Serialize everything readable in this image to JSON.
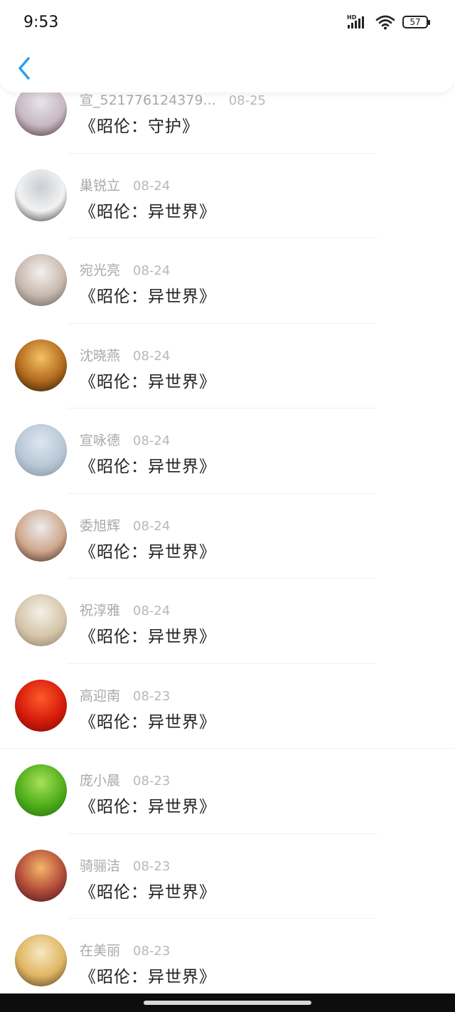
{
  "status_bar": {
    "time": "9:53",
    "hd_label": "HD",
    "battery": "57"
  },
  "nav": {
    "back_icon": "chevron-left-icon",
    "accent_color": "#2a9df4"
  },
  "entries": [
    {
      "name": "宣_521776124379...",
      "date": "08-25",
      "title": "《昭伦：守护》",
      "avatar_colors": [
        "#e8e4ea",
        "#c7b8c4",
        "#3b2a2b"
      ]
    },
    {
      "name": "巢锐立",
      "date": "08-24",
      "title": "《昭伦：异世界》",
      "avatar_colors": [
        "#c9cfd4",
        "#f2f2f2",
        "#2d2d2d"
      ]
    },
    {
      "name": "宛光亮",
      "date": "08-24",
      "title": "《昭伦：异世界》",
      "avatar_colors": [
        "#f4f1ef",
        "#c7b9ae",
        "#5d5a57"
      ]
    },
    {
      "name": "沈晓燕",
      "date": "08-24",
      "title": "《昭伦：异世界》",
      "avatar_colors": [
        "#f6c267",
        "#b26a1c",
        "#1e1206"
      ]
    },
    {
      "name": "宣咏德",
      "date": "08-24",
      "title": "《昭伦：异世界》",
      "avatar_colors": [
        "#dbe6f1",
        "#b9c8d6",
        "#7f8c97"
      ]
    },
    {
      "name": "委旭辉",
      "date": "08-24",
      "title": "《昭伦：异世界》",
      "avatar_colors": [
        "#ececec",
        "#cfa88d",
        "#3a1f1a"
      ]
    },
    {
      "name": "祝淳雅",
      "date": "08-24",
      "title": "《昭伦：异世界》",
      "avatar_colors": [
        "#f4f0e8",
        "#d6c6aa",
        "#8a7a66"
      ]
    },
    {
      "name": "高迎南",
      "date": "08-23",
      "title": "《昭伦：异世界》",
      "avatar_colors": [
        "#ff5a2a",
        "#d41c0b",
        "#7a0505"
      ]
    },
    {
      "name": "庞小晨",
      "date": "08-23",
      "title": "《昭伦：异世界》",
      "avatar_colors": [
        "#a8e05a",
        "#4fae1a",
        "#1f6a0c"
      ]
    },
    {
      "name": "骑骊洁",
      "date": "08-23",
      "title": "《昭伦：异世界》",
      "avatar_colors": [
        "#f6b56a",
        "#b14a38",
        "#3c1420"
      ]
    },
    {
      "name": "在美丽",
      "date": "08-23",
      "title": "《昭伦：异世界》",
      "avatar_colors": [
        "#f6e9c0",
        "#e0b562",
        "#4a3522"
      ]
    }
  ]
}
